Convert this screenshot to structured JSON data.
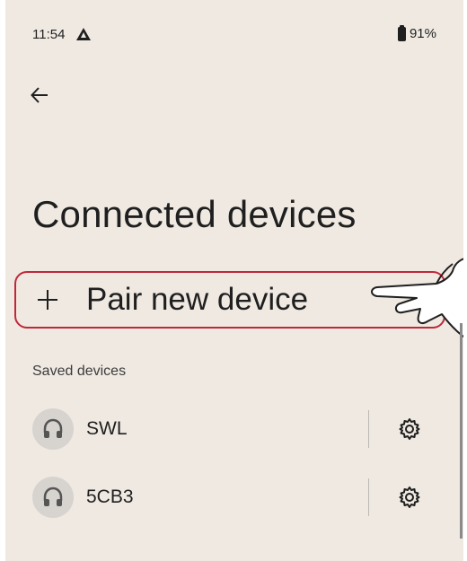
{
  "status_bar": {
    "time": "11:54",
    "battery_percent": "91%",
    "warning_icon": "warning-triangle-icon"
  },
  "nav": {
    "back_icon": "arrow-left-icon"
  },
  "page": {
    "title": "Connected devices"
  },
  "pair_button": {
    "icon": "plus-icon",
    "label": "Pair new device",
    "highlight_color": "#c0283a"
  },
  "saved_devices": {
    "section_title": "Saved devices",
    "items": [
      {
        "name": "SWL",
        "icon": "headphones-icon",
        "settings_icon": "gear-icon"
      },
      {
        "name": "5CB3",
        "icon": "headphones-icon",
        "settings_icon": "gear-icon"
      }
    ]
  },
  "colors": {
    "background": "#efe9e2",
    "text": "#1f1f1f",
    "avatar_bg": "#d7d3cf"
  }
}
